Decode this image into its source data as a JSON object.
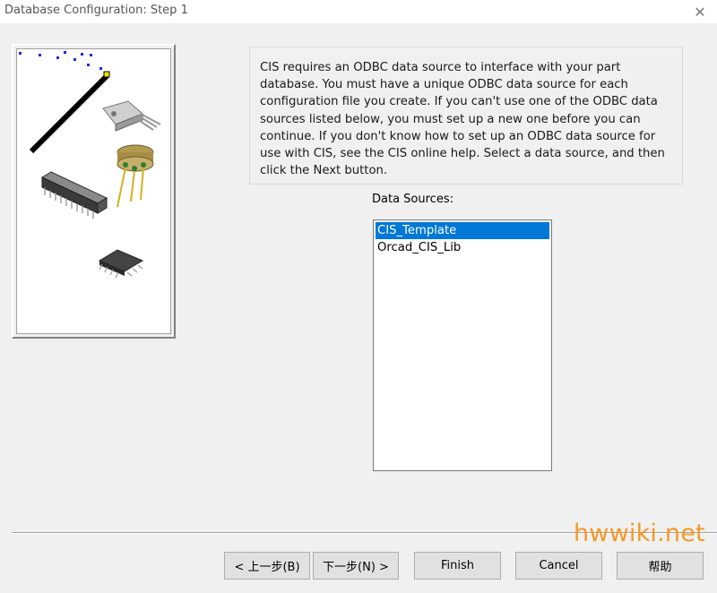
{
  "window": {
    "title": "Database Configuration: Step 1",
    "close_icon": "close-icon"
  },
  "description": "CIS requires an ODBC data source to interface with your part database. You must have a unique ODBC data source for each configuration file you create. If you can't use one of the ODBC data sources listed below, you must set up a new one before you can continue. If you don't know how to set up an ODBC data source for use with CIS, see the CIS online help.  Select a data source, and then click the Next button.",
  "data_sources": {
    "label": "Data Sources:",
    "items": [
      {
        "label": "CIS_Template",
        "selected": true
      },
      {
        "label": "Orcad_CIS_Lib",
        "selected": false
      }
    ]
  },
  "buttons": {
    "back": "< 上一步(B)",
    "next": "下一步(N) >",
    "finish": "Finish",
    "cancel": "Cancel",
    "help": "帮助"
  },
  "watermark": "hwwiki.net",
  "colors": {
    "selection": "#0078d7",
    "watermark": "#f39a27"
  }
}
